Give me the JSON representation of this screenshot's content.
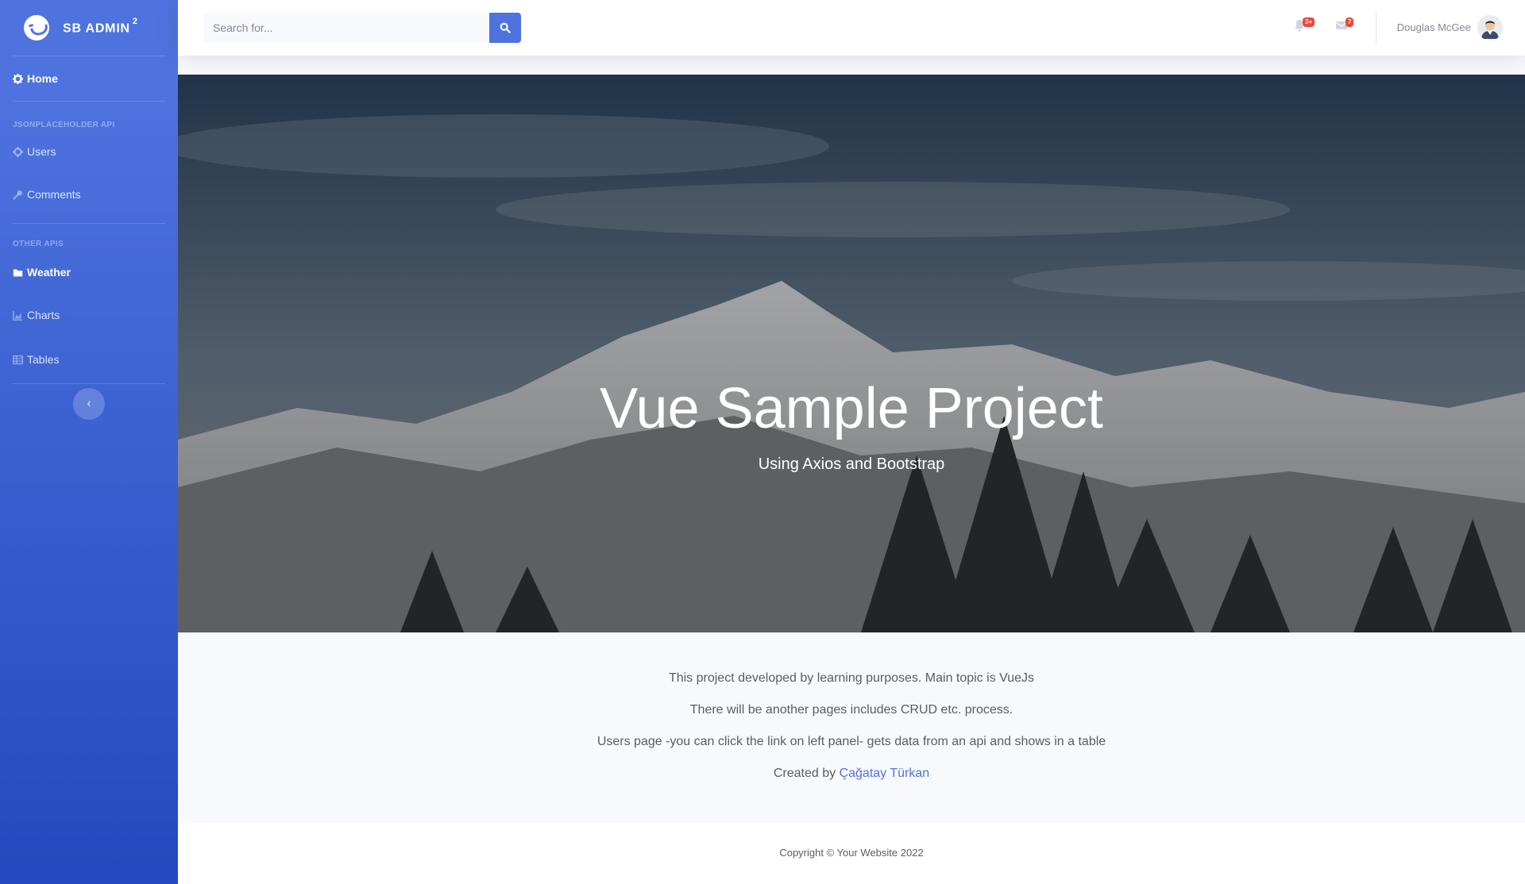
{
  "sidebar": {
    "brand": "SB Admin",
    "brand_sup": "2",
    "home": "Home",
    "heading_1": "JSONPLACEHOLDER API",
    "users": "Users",
    "comments": "Comments",
    "heading_2": "OTHER APIS",
    "weather": "Weather",
    "charts": "Charts",
    "tables": "Tables"
  },
  "topbar": {
    "search_placeholder": "Search for...",
    "alerts_badge": "3+",
    "messages_badge": "7",
    "user_name": "Douglas McGee"
  },
  "hero": {
    "title": "Vue Sample Project",
    "subtitle": "Using Axios and Bootstrap"
  },
  "content": {
    "line1": "This project developed by learning purposes. Main topic is VueJs",
    "line2": "There will be another pages includes CRUD etc. process.",
    "line3": "Users page -you can click the link on left panel- gets data from an api and shows in a table",
    "created_by": "Created by",
    "author": "Çağatay Türkan"
  },
  "footer": {
    "copyright": "Copyright © Your Website 2022"
  },
  "colors": {
    "primary": "#4e73df",
    "primary_dark": "#224abe",
    "danger": "#e74a3b"
  }
}
